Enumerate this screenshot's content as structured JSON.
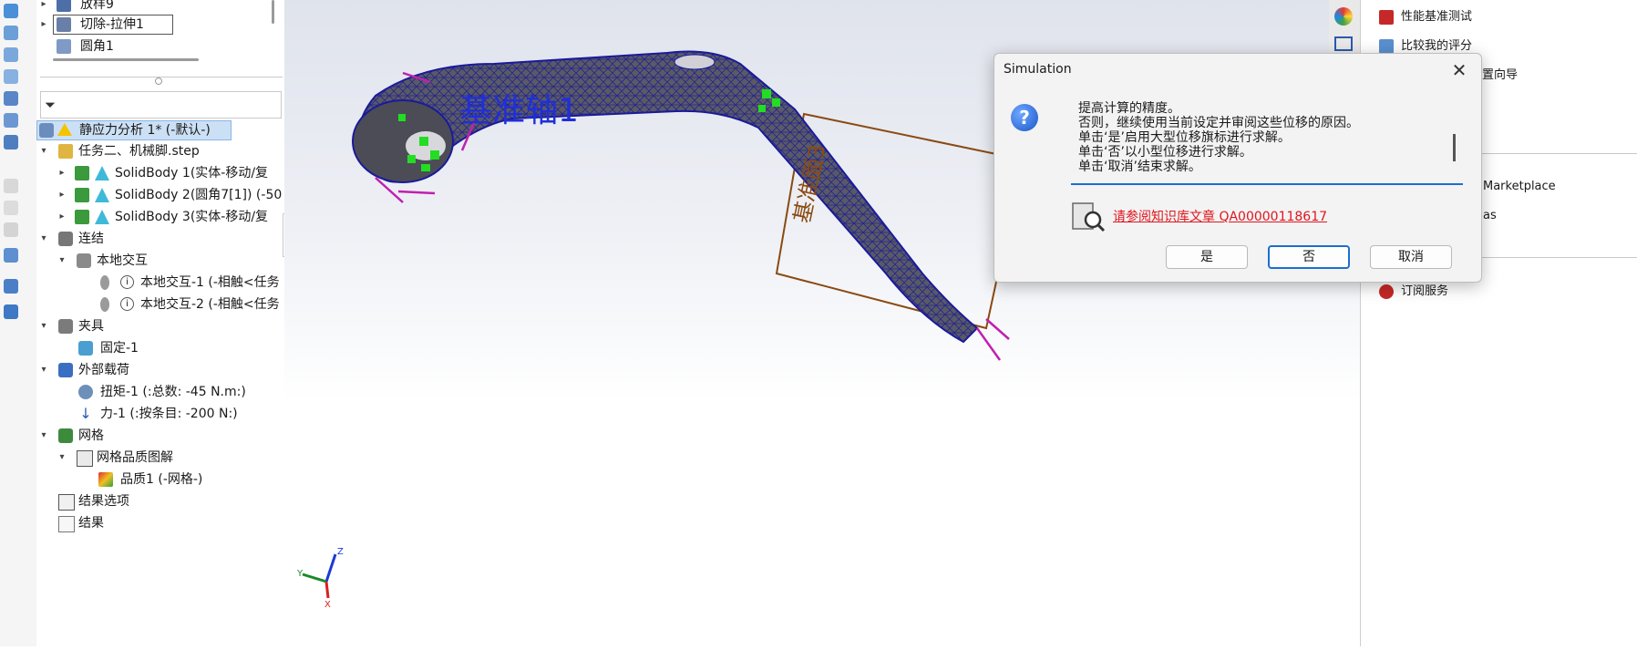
{
  "tree": {
    "items": [
      {
        "label": "放样9"
      },
      {
        "label": "切除-拉伸1"
      },
      {
        "label": "圆角1"
      },
      {
        "label": "静应力分析 1* (-默认-)"
      },
      {
        "label": "任务二、机械脚.step"
      },
      {
        "label": "SolidBody 1(实体-移动/复"
      },
      {
        "label": "SolidBody 2(圆角7[1]) (-50"
      },
      {
        "label": "SolidBody 3(实体-移动/复"
      },
      {
        "label": "连结"
      },
      {
        "label": "本地交互"
      },
      {
        "label": "本地交互-1 (-相触<任务"
      },
      {
        "label": "本地交互-2 (-相触<任务"
      },
      {
        "label": "夹具"
      },
      {
        "label": "固定-1"
      },
      {
        "label": "外部载荷"
      },
      {
        "label": "扭矩-1 (:总数: -45 N.m:)"
      },
      {
        "label": "力-1 (:按条目: -200 N:)"
      },
      {
        "label": "网格"
      },
      {
        "label": "网格品质图解"
      },
      {
        "label": "品质1 (-网格-)"
      },
      {
        "label": "结果选项"
      },
      {
        "label": "结果"
      }
    ]
  },
  "viewport": {
    "axis_label": "基准轴1",
    "plane_label": "基准面3",
    "triad": {
      "x": "X",
      "y": "Y",
      "z": "Z"
    }
  },
  "task_pane": {
    "items": [
      {
        "label": "性能基准测试"
      },
      {
        "label": "比较我的评分"
      },
      {
        "label": "设置向导"
      },
      {
        "label": "Marketplace"
      },
      {
        "label": "as"
      },
      {
        "label": "订阅服务"
      }
    ]
  },
  "dialog": {
    "title": "Simulation",
    "close_glyph": "✕",
    "message_lines": [
      "提高计算的精度。",
      "否则，继续使用当前设定并审阅这些位移的原因。",
      "单击‘是’启用大型位移旗标进行求解。",
      "单击‘否’以小型位移进行求解。",
      "单击‘取消’结束求解。"
    ],
    "kb_link": "请参阅知识库文章 QA00000118617",
    "buttons": {
      "yes": "是",
      "no": "否",
      "cancel": "取消"
    }
  },
  "colors": {
    "mesh": "#1a1a9a",
    "part": "#5a5a64",
    "plane": "#8a4a12",
    "link": "#e0151d",
    "accent": "#1a6fd0",
    "warning": "#f5c400",
    "selected_bg": "#cce0f5"
  }
}
